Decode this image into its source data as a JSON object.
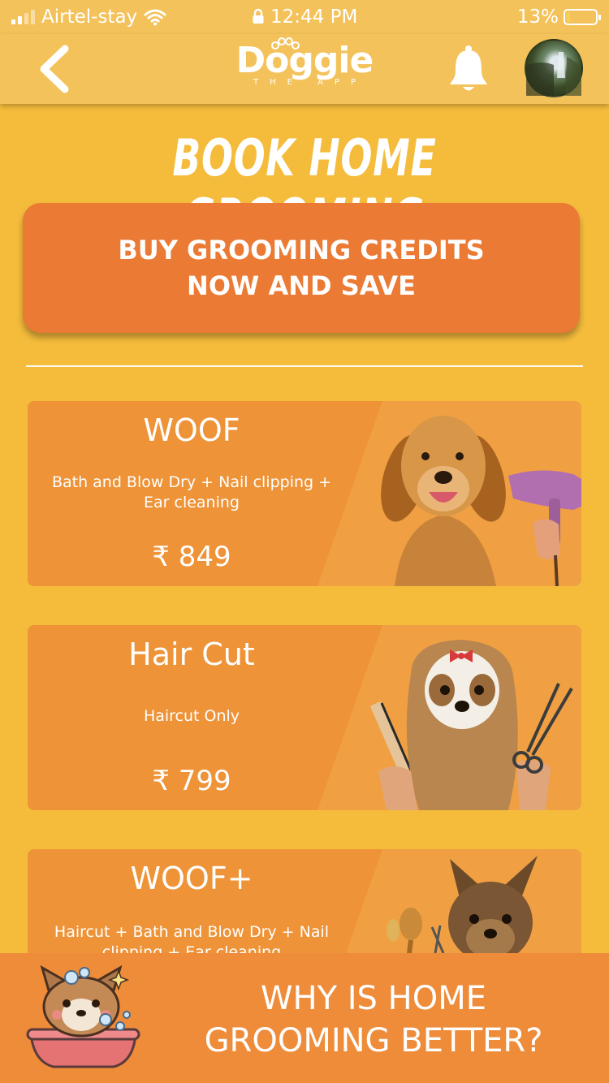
{
  "status_bar": {
    "carrier": "Airtel-stay",
    "time": "12:44 PM",
    "battery": "13%",
    "battery_level": 0.13
  },
  "header": {
    "back_icon": "chevron-left-icon",
    "logo_main": "Doggie",
    "logo_sub": "THE APP",
    "bell_icon": "bell-icon",
    "avatar_icon": "user-avatar"
  },
  "page": {
    "title": "BOOK HOME GROOMING"
  },
  "promo": {
    "line1": "BUY GROOMING CREDITS",
    "line2": "NOW AND SAVE"
  },
  "services": [
    {
      "title": "WOOF",
      "description": "Bath and Blow Dry + Nail clipping + Ear cleaning",
      "price": "₹ 849"
    },
    {
      "title": "Hair Cut",
      "description": "Haircut Only",
      "price": "₹ 799"
    },
    {
      "title": "WOOF+",
      "description": "Haircut + Bath and Blow Dry + Nail clipping + Ear cleaning",
      "price": ""
    }
  ],
  "footer": {
    "line1": "WHY IS HOME",
    "line2": "GROOMING BETTER?"
  },
  "colors": {
    "background": "#F5BC3C",
    "header": "#F4C25A",
    "promo": "#EA7A34",
    "card": "#EE9337",
    "footer": "#EE8C3A"
  }
}
